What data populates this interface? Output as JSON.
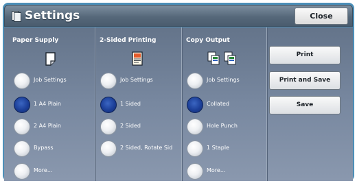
{
  "window": {
    "title": "Settings",
    "close_label": "Close"
  },
  "columns": [
    {
      "header": "Paper Supply",
      "icon": "paper-sheet-icon",
      "options": [
        {
          "label": "Job Settings",
          "selected": false
        },
        {
          "label": "1 A4 Plain",
          "selected": true
        },
        {
          "label": "2 A4 Plain",
          "selected": false
        },
        {
          "label": "Bypass",
          "selected": false
        },
        {
          "label": "More...",
          "selected": false
        }
      ]
    },
    {
      "header": "2-Sided Printing",
      "icon": "two-sided-document-icon",
      "options": [
        {
          "label": "Job Settings",
          "selected": false
        },
        {
          "label": "1 Sided",
          "selected": true
        },
        {
          "label": "2 Sided",
          "selected": false
        },
        {
          "label": "2 Sided, Rotate Sid",
          "selected": false
        }
      ]
    },
    {
      "header": "Copy Output",
      "icon": "collated-copies-icon",
      "options": [
        {
          "label": "Job Settings",
          "selected": false
        },
        {
          "label": "Collated",
          "selected": true
        },
        {
          "label": "Hole Punch",
          "selected": false
        },
        {
          "label": "1 Staple",
          "selected": false
        },
        {
          "label": "More...",
          "selected": false
        }
      ]
    }
  ],
  "actions": {
    "print": "Print",
    "print_and_save": "Print and Save",
    "save": "Save"
  },
  "colors": {
    "selected_radio": "#1c3f98",
    "title_bar": "#56687a",
    "panel": "#7888a0"
  }
}
